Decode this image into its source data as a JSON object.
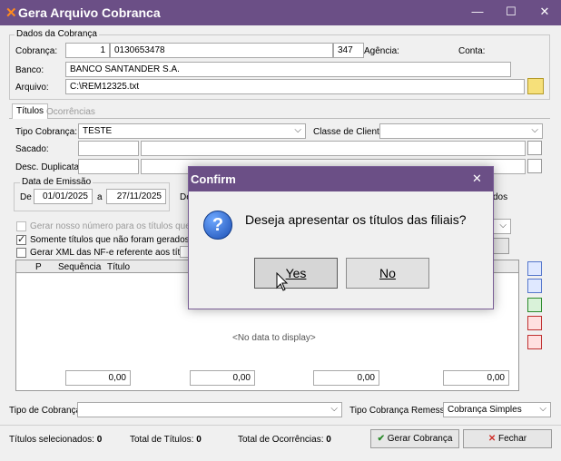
{
  "window": {
    "title": "Gera Arquivo Cobranca",
    "minimize": "—",
    "maximize": "☐",
    "close": "✕"
  },
  "dados": {
    "group_label": "Dados da Cobrança",
    "cobranca_label": "Cobrança:",
    "cobranca_num": "1",
    "cobranca_code": "0130653478",
    "cobranca_extra": "347",
    "agencia_label": "Agência:",
    "conta_label": "Conta:",
    "banco_label": "Banco:",
    "banco_value": "BANCO SANTANDER S.A.",
    "arquivo_label": "Arquivo:",
    "arquivo_value": "C:\\REM12325.txt"
  },
  "tabs": [
    {
      "label": "Títulos"
    },
    {
      "label": "Ocorrências"
    }
  ],
  "titulos": {
    "tipo_cobranca_label": "Tipo Cobrança:",
    "tipo_cobranca_value": "TESTE",
    "classe_cliente_label": "Classe de Cliente:",
    "sacado_label": "Sacado:",
    "desc_duplicata_label": "Desc. Duplicata:",
    "data_emissao_label": "Data de Emissão",
    "de_label": "De",
    "de_value": "01/01/2025",
    "a_label": "a",
    "a_value": "27/11/2025",
    "de2_label": "De",
    "dos_label": "dos",
    "chk_gerar_nosso": "Gerar nosso número para os títulos que já fora",
    "chk_somente": "Somente títulos que não foram gerados em re",
    "chk_gerar_xml": "Gerar XML das NF-e referente aos títulos",
    "grid_cols": [
      "P",
      "Sequência",
      "Título"
    ],
    "no_data": "<No data to display>",
    "totals": [
      "0,00",
      "0,00",
      "0,00",
      "0,00"
    ]
  },
  "bottom": {
    "tipo_cobranca_label": "Tipo de Cobrança:",
    "tipo_remessa_label": "Tipo Cobrança Remessa:",
    "tipo_remessa_value": "Cobrança Simples",
    "selecionados_label": "Títulos selecionados:",
    "selecionados_value": "0",
    "total_titulos_label": "Total de Títulos:",
    "total_titulos_value": "0",
    "total_ocorrencias_label": "Total de Ocorrências:",
    "total_ocorrencias_value": "0",
    "gerar_button": "Gerar Cobrança",
    "fechar_button": "Fechar"
  },
  "dialog": {
    "title": "Confirm",
    "close": "✕",
    "message": "Deseja apresentar os títulos das filiais?",
    "yes": "Yes",
    "no": "No",
    "icon": "question-icon"
  }
}
